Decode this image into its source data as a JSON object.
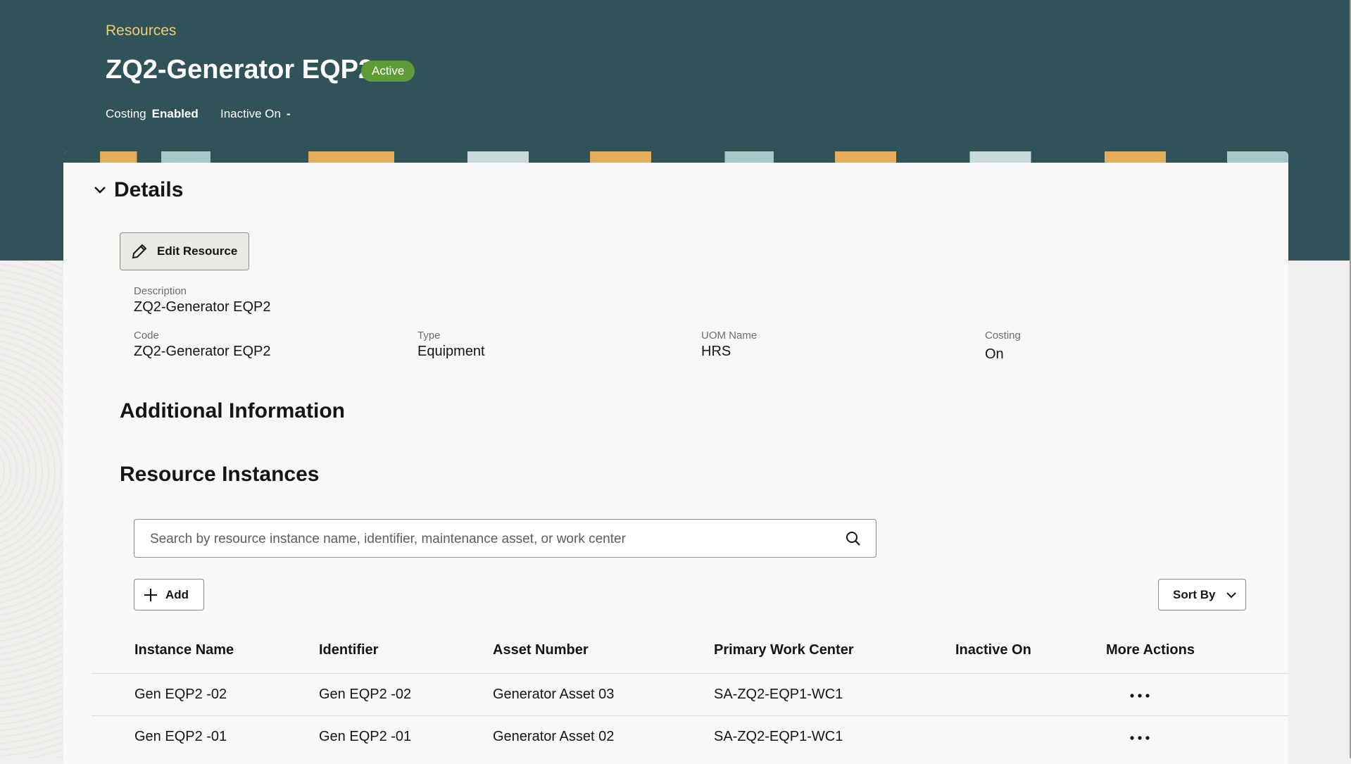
{
  "header": {
    "breadcrumb": "Resources",
    "title": "ZQ2-Generator EQP2",
    "status": "Active",
    "meta": [
      {
        "label": "Costing",
        "value": "Enabled"
      },
      {
        "label": "Inactive On",
        "value": "-"
      }
    ]
  },
  "details": {
    "heading": "Details",
    "edit_label": "Edit Resource",
    "fields": {
      "description": {
        "label": "Description",
        "value": "ZQ2-Generator EQP2"
      },
      "code": {
        "label": "Code",
        "value": "ZQ2-Generator EQP2"
      },
      "type": {
        "label": "Type",
        "value": "Equipment"
      },
      "uom": {
        "label": "UOM Name",
        "value": "HRS"
      },
      "costing": {
        "label": "Costing",
        "value": "On"
      }
    }
  },
  "additional": {
    "heading": "Additional Information"
  },
  "instances": {
    "heading": "Resource Instances",
    "search_placeholder": "Search by resource instance name, identifier, maintenance asset, or work center",
    "add_label": "Add",
    "sort_label": "Sort By",
    "columns": [
      "Instance Name",
      "Identifier",
      "Asset Number",
      "Primary Work Center",
      "Inactive On",
      "More Actions"
    ],
    "rows": [
      {
        "name": "Gen EQP2 -02",
        "identifier": "Gen EQP2 -02",
        "asset": "Generator Asset 03",
        "work_center": "SA-ZQ2-EQP1-WC1",
        "inactive_on": ""
      },
      {
        "name": "Gen EQP2 -01",
        "identifier": "Gen EQP2 -01",
        "asset": "Generator Asset 02",
        "work_center": "SA-ZQ2-EQP1-WC1",
        "inactive_on": ""
      }
    ]
  },
  "colors": {
    "header_bg": "#30535a",
    "breadcrumb": "#f0cc71",
    "status_badge": "#5e9c37",
    "page_bg": "#f1efed",
    "card_bg": "#f9f8f6"
  }
}
